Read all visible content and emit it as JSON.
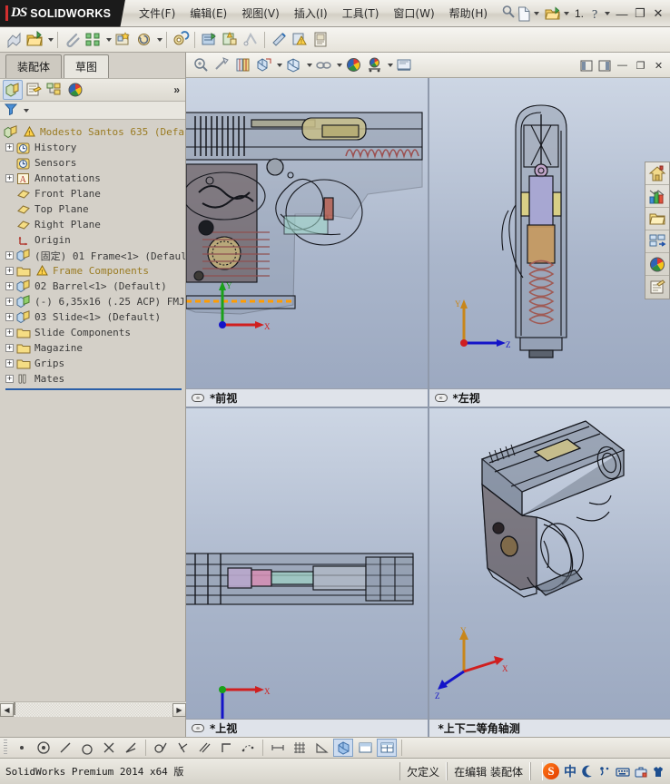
{
  "app": {
    "brand_ds": "DS",
    "brand_name": "SOLIDWORKS",
    "accent_color": "#d12f2f",
    "titlebar_bg": "#1b1b1b"
  },
  "menubar": {
    "items": [
      {
        "label": "文件(F)",
        "name": "menu-file"
      },
      {
        "label": "编辑(E)",
        "name": "menu-edit"
      },
      {
        "label": "视图(V)",
        "name": "menu-view"
      },
      {
        "label": "插入(I)",
        "name": "menu-insert"
      },
      {
        "label": "工具(T)",
        "name": "menu-tools"
      },
      {
        "label": "窗口(W)",
        "name": "menu-window"
      },
      {
        "label": "帮助(H)",
        "name": "menu-help"
      }
    ],
    "search_icon": "magnifier-icon"
  },
  "title_right": {
    "new_doc_icon": "new-document-icon",
    "open_doc_icon": "open-folder-icon",
    "counter": "1.",
    "help_icon": "question-mark-icon",
    "minimize": "—",
    "restore": "❐",
    "close": "✕"
  },
  "toolbar": {
    "items": [
      {
        "name": "rebuild-icon",
        "glyph": "rebuild"
      },
      {
        "name": "open-assembly-icon",
        "glyph": "openfolder",
        "dropdown": true
      },
      {
        "name": "sep",
        "glyph": "sep"
      },
      {
        "name": "measure-icon",
        "glyph": "clip"
      },
      {
        "name": "mate-icon",
        "glyph": "mate",
        "dropdown": true
      },
      {
        "name": "new-component-icon",
        "glyph": "newcomp"
      },
      {
        "name": "rotate-component-icon",
        "glyph": "rotate",
        "dropdown": true
      },
      {
        "name": "sep",
        "glyph": "sep"
      },
      {
        "name": "smart-fasteners-icon",
        "glyph": "fastener"
      },
      {
        "name": "exploded-view-icon",
        "glyph": "explode",
        "dropdown": true
      },
      {
        "name": "interference-detection-icon",
        "glyph": "interf",
        "dropdown": true
      },
      {
        "name": "sep",
        "glyph": "sep"
      },
      {
        "name": "bom-icon",
        "glyph": "bom"
      },
      {
        "name": "assembly-visualization-icon",
        "glyph": "visual"
      },
      {
        "name": "sensor-icon",
        "glyph": "sensor"
      },
      {
        "name": "belt-chain-icon",
        "glyph": "belt"
      },
      {
        "name": "performance-icon",
        "glyph": "perf"
      },
      {
        "name": "warning-tools-icon",
        "glyph": "warn"
      },
      {
        "name": "drawing-icon",
        "glyph": "drawing"
      }
    ]
  },
  "left_panel": {
    "tabs": [
      {
        "label": "装配体",
        "name": "doc-tab-assembly",
        "active": false
      },
      {
        "label": "草图",
        "name": "doc-tab-sketch",
        "active": true
      }
    ],
    "fm_buttons": [
      {
        "name": "feature-manager-tab-icon",
        "selected": true
      },
      {
        "name": "property-manager-tab-icon",
        "selected": false
      },
      {
        "name": "configuration-manager-tab-icon",
        "selected": false
      },
      {
        "name": "display-manager-tab-icon",
        "selected": false
      }
    ],
    "fm_more": "»",
    "filter_icon": "filter-funnel-icon",
    "tree": [
      {
        "label": "Modesto Santos 635  (Defaul",
        "icon": "assembly-icon",
        "indent": 0,
        "expand": "none",
        "warn": true,
        "color": "amber",
        "dots": false
      },
      {
        "label": "History",
        "icon": "history-icon",
        "indent": 1,
        "expand": "plus",
        "warn": false,
        "color": "dark",
        "dots": true
      },
      {
        "label": "Sensors",
        "icon": "sensors-icon",
        "indent": 1,
        "expand": "none",
        "warn": false,
        "color": "dark",
        "dots": true
      },
      {
        "label": "Annotations",
        "icon": "annotations-icon",
        "indent": 1,
        "expand": "plus",
        "warn": false,
        "color": "dark",
        "dots": true
      },
      {
        "label": "Front Plane",
        "icon": "plane-icon",
        "indent": 1,
        "expand": "none",
        "warn": false,
        "color": "dark",
        "dots": true
      },
      {
        "label": "Top Plane",
        "icon": "plane-icon",
        "indent": 1,
        "expand": "none",
        "warn": false,
        "color": "dark",
        "dots": true
      },
      {
        "label": "Right Plane",
        "icon": "plane-icon",
        "indent": 1,
        "expand": "none",
        "warn": false,
        "color": "dark",
        "dots": true
      },
      {
        "label": "Origin",
        "icon": "origin-icon",
        "indent": 1,
        "expand": "none",
        "warn": false,
        "color": "dark",
        "dots": true
      },
      {
        "label": "(固定) 01 Frame<1> (Default",
        "icon": "component-icon",
        "indent": 1,
        "expand": "plus",
        "warn": false,
        "color": "dark",
        "dots": false
      },
      {
        "label": "Frame Components",
        "icon": "folder-icon",
        "indent": 1,
        "expand": "plus",
        "warn": true,
        "color": "amber",
        "dots": false
      },
      {
        "label": "02 Barrel<1> (Default)",
        "icon": "component-icon",
        "indent": 1,
        "expand": "plus",
        "warn": false,
        "color": "dark",
        "dots": false
      },
      {
        "label": "(-) 6,35x16 (.25 ACP) FMJ (",
        "icon": "component-green-icon",
        "indent": 1,
        "expand": "plus",
        "warn": false,
        "color": "dark",
        "dots": false
      },
      {
        "label": "03 Slide<1> (Default)",
        "icon": "component-icon",
        "indent": 1,
        "expand": "plus",
        "warn": false,
        "color": "dark",
        "dots": false
      },
      {
        "label": "Slide Components",
        "icon": "folder-icon",
        "indent": 1,
        "expand": "plus",
        "warn": false,
        "color": "dark",
        "dots": false
      },
      {
        "label": "Magazine",
        "icon": "folder-icon",
        "indent": 1,
        "expand": "plus",
        "warn": false,
        "color": "dark",
        "dots": false
      },
      {
        "label": "Grips",
        "icon": "folder-icon",
        "indent": 1,
        "expand": "plus",
        "warn": false,
        "color": "dark",
        "dots": false
      },
      {
        "label": "Mates",
        "icon": "mates-icon",
        "indent": 1,
        "expand": "plus",
        "warn": false,
        "color": "dark",
        "dots": false
      }
    ],
    "hscroll": {
      "left_arrow": "◀",
      "right_arrow": "▶"
    }
  },
  "viewport_toolbar": {
    "items": [
      {
        "name": "zoom-to-fit-icon",
        "glyph": "zoomfit"
      },
      {
        "name": "section-view-icon",
        "glyph": "section"
      },
      {
        "name": "view-orientation-icon",
        "glyph": "orient"
      },
      {
        "name": "display-style-icon",
        "glyph": "style",
        "dropdown": true
      },
      {
        "name": "hide-show-items-icon",
        "glyph": "hideshow",
        "dropdown": true
      },
      {
        "name": "edit-appearance-icon",
        "glyph": "appearance",
        "dropdown": true
      },
      {
        "name": "apply-scene-icon",
        "glyph": "scene",
        "dropdown": true
      },
      {
        "name": "view-settings-icon",
        "glyph": "viewsettings"
      }
    ],
    "window_buttons": [
      {
        "name": "tile-left-icon",
        "glyph": "◧"
      },
      {
        "name": "tile-right-icon",
        "glyph": "◨"
      },
      {
        "name": "minimize-doc-icon",
        "glyph": "—"
      },
      {
        "name": "restore-doc-icon",
        "glyph": "❐"
      },
      {
        "name": "close-doc-icon",
        "glyph": "✕"
      }
    ]
  },
  "viewports": [
    {
      "name": "viewport-front",
      "label": "*前视",
      "pin": "link-icon",
      "triad": "xy"
    },
    {
      "name": "viewport-left",
      "label": "*左视",
      "pin": "link-icon",
      "triad": "zy"
    },
    {
      "name": "viewport-top",
      "label": "*上视",
      "pin": "link-icon",
      "triad": "xz"
    },
    {
      "name": "viewport-dimetric",
      "label": "*上下二等角轴测",
      "pin": "none",
      "triad": "iso"
    }
  ],
  "task_pane": {
    "buttons": [
      {
        "name": "task-pane-resources-icon",
        "glyph": "home"
      },
      {
        "name": "task-pane-design-library-icon",
        "glyph": "chart"
      },
      {
        "name": "task-pane-file-explorer-icon",
        "glyph": "folder"
      },
      {
        "name": "task-pane-view-palette-icon",
        "glyph": "palette"
      },
      {
        "name": "task-pane-appearances-icon",
        "glyph": "sphere"
      },
      {
        "name": "task-pane-custom-properties-icon",
        "glyph": "props"
      }
    ]
  },
  "bottom_toolbar": {
    "items": [
      {
        "name": "point-relation-icon",
        "glyph": "dot",
        "selected": false
      },
      {
        "name": "concentric-relation-icon",
        "glyph": "concentric",
        "selected": false
      },
      {
        "name": "line-relation-icon",
        "glyph": "line",
        "selected": false
      },
      {
        "name": "arc-relation-icon",
        "glyph": "arc",
        "selected": false
      },
      {
        "name": "intersection-relation-icon",
        "glyph": "cross",
        "selected": false
      },
      {
        "name": "angle-relation-icon",
        "glyph": "angle",
        "selected": false
      },
      {
        "name": "sep",
        "glyph": "sep"
      },
      {
        "name": "tangent-relation-icon",
        "glyph": "tangent",
        "selected": false
      },
      {
        "name": "perpendicular-relation-icon",
        "glyph": "perp",
        "selected": false
      },
      {
        "name": "parallel-relation-icon",
        "glyph": "parallel",
        "selected": false
      },
      {
        "name": "corner-relation-icon",
        "glyph": "corner",
        "selected": false
      },
      {
        "name": "spline-relation-icon",
        "glyph": "spline",
        "selected": false
      },
      {
        "name": "sep",
        "glyph": "sep"
      },
      {
        "name": "dimension-icon",
        "glyph": "dim",
        "selected": false
      },
      {
        "name": "grid-icon",
        "glyph": "grid",
        "selected": false
      },
      {
        "name": "angle-measure-icon",
        "glyph": "anglem",
        "selected": false
      },
      {
        "name": "single-view-icon",
        "glyph": "single",
        "selected": true
      },
      {
        "name": "two-view-horizontal-icon",
        "glyph": "two",
        "selected": false
      },
      {
        "name": "four-view-icon",
        "glyph": "four",
        "selected": true
      }
    ]
  },
  "statusbar": {
    "product": "SolidWorks Premium 2014 x64 版",
    "state": "欠定义",
    "editing": "在编辑 装配体",
    "ime": {
      "sogou": "S",
      "language": "中",
      "mode_icon": "moon-icon",
      "punct_icon": "punctuation-icon",
      "keyboard_icon": "keyboard-icon",
      "toolbox_icon": "toolbox-icon",
      "skin_icon": "shirt-icon"
    }
  }
}
